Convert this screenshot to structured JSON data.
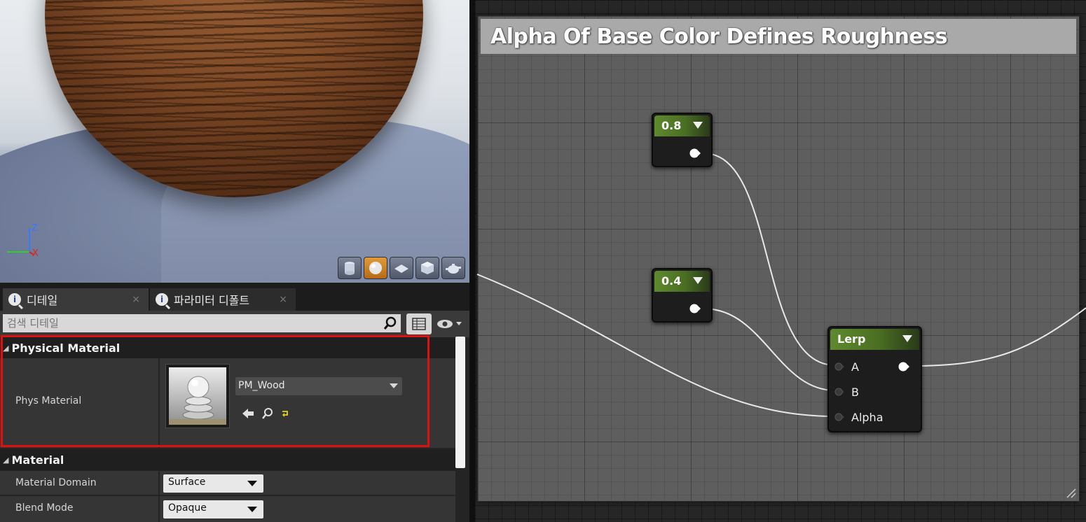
{
  "viewport": {
    "axis_z": "Z",
    "axis_x": "X",
    "axis_y": "Y",
    "toolbar_icons": [
      "cylinder-icon",
      "sphere-icon",
      "plane-icon",
      "cube-icon",
      "teapot-icon"
    ],
    "active_icon": "sphere-icon"
  },
  "details": {
    "tabs": [
      {
        "label": "디테일",
        "icon": "details-icon",
        "close": "×"
      },
      {
        "label": "파라미터 디폴트",
        "icon": "details-icon",
        "close": "×"
      }
    ],
    "search": {
      "placeholder": "검색 디테일"
    },
    "categories": {
      "physical_material": {
        "title": "Physical Material",
        "props": {
          "phys_material": {
            "label": "Phys Material",
            "value": "PM_Wood"
          }
        }
      },
      "material": {
        "title": "Material",
        "props": {
          "material_domain": {
            "label": "Material Domain",
            "value": "Surface"
          },
          "blend_mode": {
            "label": "Blend Mode",
            "value": "Opaque"
          }
        }
      }
    }
  },
  "graph": {
    "comment_title": "Alpha Of Base Color Defines Roughness",
    "nodes": {
      "const_a": {
        "value": "0.8"
      },
      "const_b": {
        "value": "0.4"
      },
      "lerp": {
        "title": "Lerp",
        "inputs": [
          "A",
          "B",
          "Alpha"
        ]
      }
    }
  },
  "colors": {
    "highlight": "#e01010",
    "node_header": "#5f8a2e",
    "accent_active": "#e09a3a"
  }
}
